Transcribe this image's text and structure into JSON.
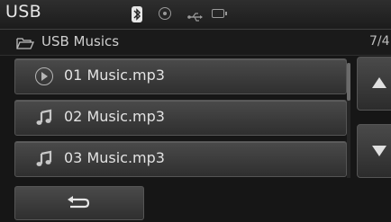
{
  "header": {
    "title": "USB",
    "icons": [
      "bluetooth-icon",
      "disc-icon",
      "usb-icon",
      "battery-icon"
    ]
  },
  "path": {
    "label": "USB Musics",
    "count": "7/4"
  },
  "list": {
    "items": [
      {
        "label": "01 Music.mp3",
        "icon": "play-circle-icon",
        "state": "playing"
      },
      {
        "label": "02 Music.mp3",
        "icon": "music-note-icon"
      },
      {
        "label": "03 Music.mp3",
        "icon": "music-note-icon"
      }
    ]
  },
  "controls": {
    "scroll_up_icon": "triangle-up-icon",
    "scroll_down_icon": "triangle-down-icon",
    "back_icon": "return-arrow-icon"
  },
  "colors": {
    "background": "#161616",
    "button": "#3c3c3c",
    "text": "#e2e2e2"
  }
}
